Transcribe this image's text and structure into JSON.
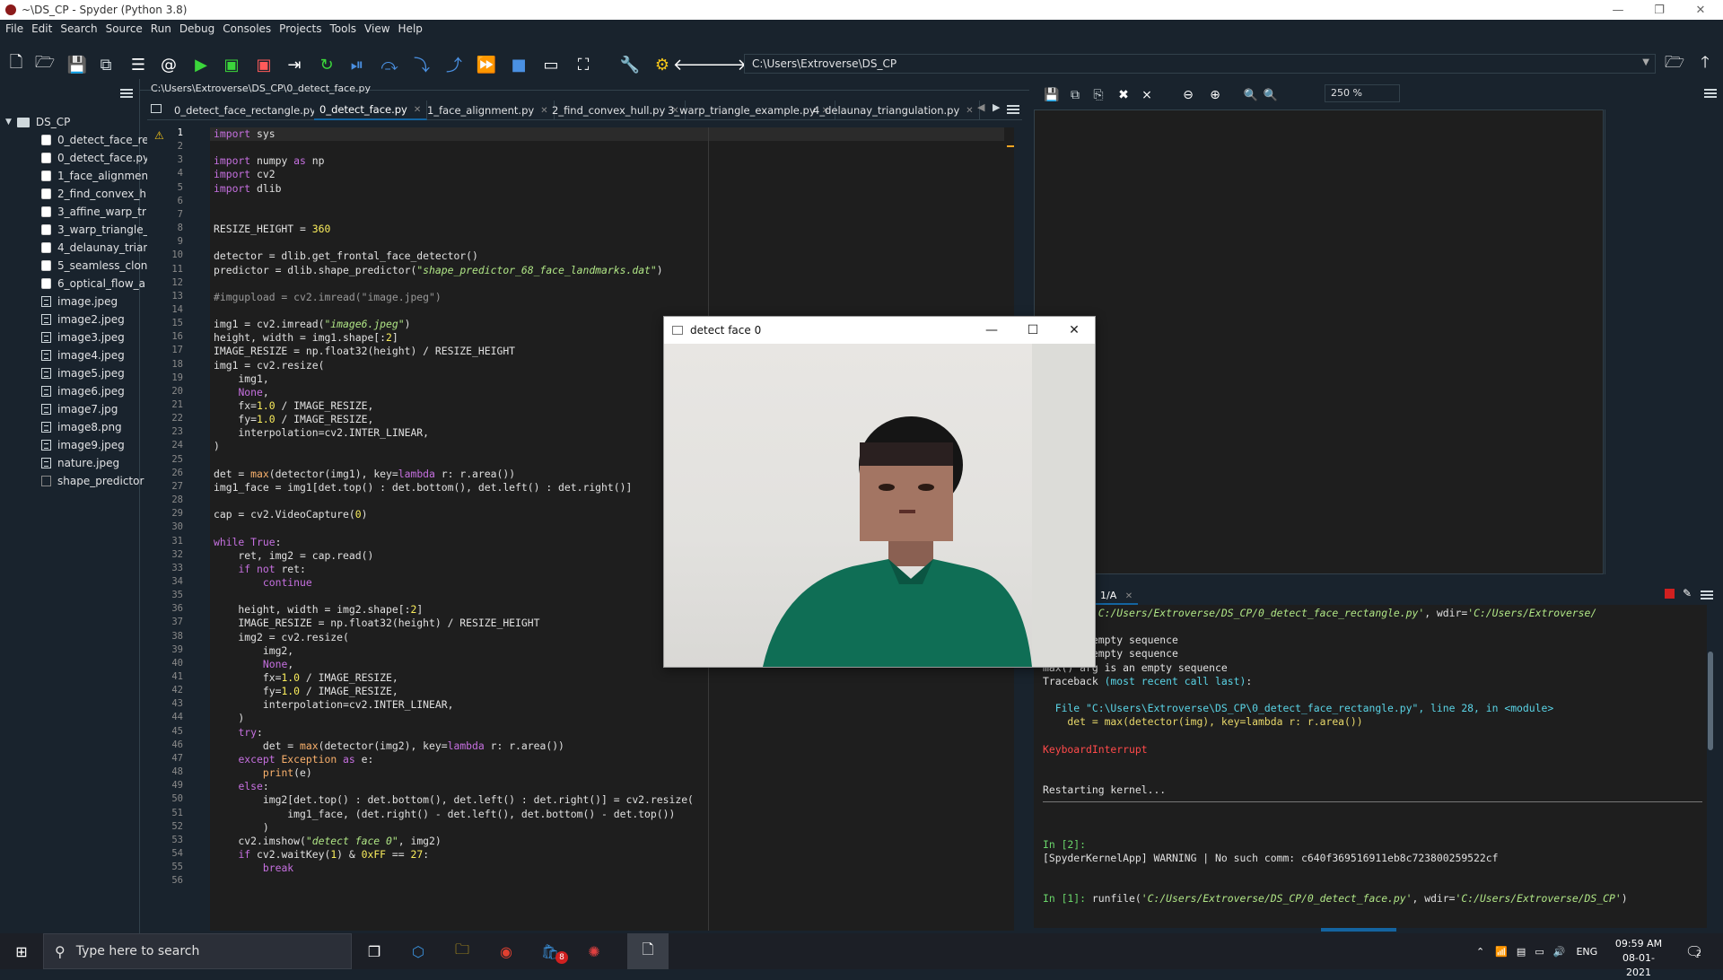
{
  "window": {
    "title": "~\\DS_CP - Spyder (Python 3.8)",
    "minimize": "—",
    "maximize": "❐",
    "close": "✕"
  },
  "menu": [
    "File",
    "Edit",
    "Search",
    "Source",
    "Run",
    "Debug",
    "Consoles",
    "Projects",
    "Tools",
    "View",
    "Help"
  ],
  "toolbar": {
    "path": "C:\\Users\\Extroverse\\DS_CP"
  },
  "project": {
    "root": "DS_CP",
    "files": [
      {
        "name": "0_detect_face_re",
        "kind": "py"
      },
      {
        "name": "0_detect_face.py",
        "kind": "py"
      },
      {
        "name": "1_face_alignmen",
        "kind": "py"
      },
      {
        "name": "2_find_convex_h",
        "kind": "py"
      },
      {
        "name": "3_affine_warp_tr",
        "kind": "py"
      },
      {
        "name": "3_warp_triangle_",
        "kind": "py"
      },
      {
        "name": "4_delaunay_trian",
        "kind": "py"
      },
      {
        "name": "5_seamless_clon",
        "kind": "py"
      },
      {
        "name": "6_optical_flow_a",
        "kind": "py"
      },
      {
        "name": "image.jpeg",
        "kind": "img"
      },
      {
        "name": "image2.jpeg",
        "kind": "img"
      },
      {
        "name": "image3.jpeg",
        "kind": "img"
      },
      {
        "name": "image4.jpeg",
        "kind": "img"
      },
      {
        "name": "image5.jpeg",
        "kind": "img"
      },
      {
        "name": "image6.jpeg",
        "kind": "img"
      },
      {
        "name": "image7.jpg",
        "kind": "img"
      },
      {
        "name": "image8.png",
        "kind": "img"
      },
      {
        "name": "image9.jpeg",
        "kind": "img"
      },
      {
        "name": "nature.jpeg",
        "kind": "img"
      },
      {
        "name": "shape_predictor",
        "kind": "dat"
      }
    ]
  },
  "editor": {
    "breadcrumb": "C:\\Users\\Extroverse\\DS_CP\\0_detect_face.py",
    "tabs": [
      {
        "label": "0_detect_face_rectangle.py",
        "active": false
      },
      {
        "label": "0_detect_face.py",
        "active": true
      },
      {
        "label": "1_face_alignment.py",
        "active": false
      },
      {
        "label": "2_find_convex_hull.py",
        "active": false
      },
      {
        "label": "3_warp_triangle_example.py",
        "active": false
      },
      {
        "label": "4_delaunay_triangulation.py",
        "active": false
      }
    ],
    "warning_line": "1",
    "code": [
      "import sys",
      "",
      "import numpy as np",
      "import cv2",
      "import dlib",
      "",
      "",
      "RESIZE_HEIGHT = 360",
      "",
      "detector = dlib.get_frontal_face_detector()",
      "predictor = dlib.shape_predictor(\"shape_predictor_68_face_landmarks.dat\")",
      "",
      "#imgupload = cv2.imread(\"image.jpeg\")",
      "",
      "img1 = cv2.imread(\"image6.jpeg\")",
      "height, width = img1.shape[:2]",
      "IMAGE_RESIZE = np.float32(height) / RESIZE_HEIGHT",
      "img1 = cv2.resize(",
      "    img1,",
      "    None,",
      "    fx=1.0 / IMAGE_RESIZE,",
      "    fy=1.0 / IMAGE_RESIZE,",
      "    interpolation=cv2.INTER_LINEAR,",
      ")",
      "",
      "det = max(detector(img1), key=lambda r: r.area())",
      "img1_face = img1[det.top() : det.bottom(), det.left() : det.right()]",
      "",
      "cap = cv2.VideoCapture(0)",
      "",
      "while True:",
      "    ret, img2 = cap.read()",
      "    if not ret:",
      "        continue",
      "",
      "    height, width = img2.shape[:2]",
      "    IMAGE_RESIZE = np.float32(height) / RESIZE_HEIGHT",
      "    img2 = cv2.resize(",
      "        img2,",
      "        None,",
      "        fx=1.0 / IMAGE_RESIZE,",
      "        fy=1.0 / IMAGE_RESIZE,",
      "        interpolation=cv2.INTER_LINEAR,",
      "    )",
      "    try:",
      "        det = max(detector(img2), key=lambda r: r.area())",
      "    except Exception as e:",
      "        print(e)",
      "    else:",
      "        img2[det.top() : det.bottom(), det.left() : det.right()] = cv2.resize(",
      "            img1_face, (det.right() - det.left(), det.bottom() - det.top())",
      "        )",
      "    cv2.imshow(\"detect face 0\", img2)",
      "    if cv2.waitKey(1) & 0xFF == 27:",
      "        break",
      ""
    ]
  },
  "plots": {
    "zoom": "250 %"
  },
  "cv_window": {
    "title": "detect face 0"
  },
  "console": {
    "tab": "1/A",
    "lines": [
      "runfile('C:/Users/Extroverse/DS_CP/0_detect_face_rectangle.py', wdir='C:/Users/Extroverse/",
      "",
      "g is an empty sequence",
      "g is an empty sequence",
      "max() arg is an empty sequence",
      "Traceback (most recent call last):",
      "",
      "  File \"C:\\Users\\Extroverse\\DS_CP\\0_detect_face_rectangle.py\", line 28, in <module>",
      "    det = max(detector(img), key=lambda r: r.area())",
      "",
      "KeyboardInterrupt",
      "",
      "",
      "Restarting kernel...",
      "",
      "",
      "",
      "In [2]:",
      "[SpyderKernelApp] WARNING | No such comm: c640f369516911eb8c723800259522cf",
      "",
      "",
      "In [1]: runfile('C:/Users/Extroverse/DS_CP/0_detect_face.py', wdir='C:/Users/Extroverse/DS_CP')"
    ]
  },
  "taskbar": {
    "search_placeholder": "Type here to search",
    "lang": "ENG",
    "time": "09:59 AM",
    "date": "08-01-2021",
    "badge": "8",
    "notif": "2"
  }
}
